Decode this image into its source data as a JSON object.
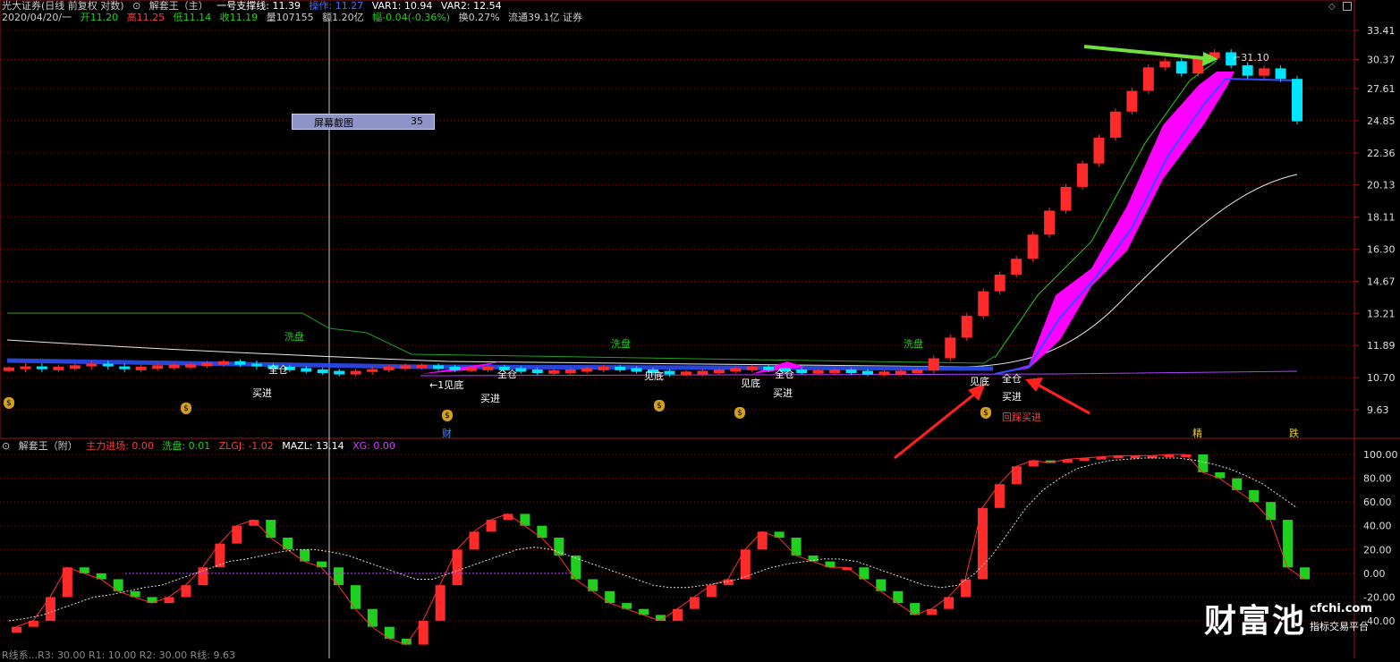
{
  "header": {
    "title": "光大证券(日线 前复权 对数)",
    "indicator_main": "解套王（主）",
    "support_label": "一号支撑线: 11.39",
    "var_blue": "操作: 11.27",
    "var1": "VAR1: 10.94",
    "var2": "VAR2: 12.54",
    "quote_date": "2020/04/20/一",
    "open": "开11.20",
    "high": "高11.25",
    "low": "低11.14",
    "close": "收11.19",
    "volume": "量107155",
    "amount": "额1.20亿",
    "change": "幅-0.04(-0.36%)",
    "turnover": "换0.27%",
    "float_cap": "流通39.1亿 证券"
  },
  "sub_header": {
    "indicator": "解套王（附）",
    "zljc": "主力进场: 0.00",
    "xipan": "洗盘: 0.01",
    "zlgj": "ZLGJ: -1.02",
    "mazl": "MAZL: 13.14",
    "xg": "XG: 0.00"
  },
  "bottom_label": "R线系...R3: 30.00  R1: 10.00  R2: 30.00  R线: 9.63",
  "screenshot_box": {
    "label": "屏幕截图",
    "value": "35"
  },
  "price_axis": [
    "33.41",
    "30.37",
    "27.61",
    "24.85",
    "22.36",
    "20.13",
    "18.11",
    "16.30",
    "14.67",
    "13.21",
    "11.89",
    "10.70",
    "9.63"
  ],
  "osc_axis": [
    "100.00",
    "80.00",
    "60.00",
    "40.00",
    "20.00",
    "0.00",
    "-20.00",
    "-40.00"
  ],
  "peak_label": "31.10",
  "signals": {
    "xipan": "洗盘",
    "quancang": "全仓",
    "mairu": "买进",
    "jiandi": "见底",
    "jiandi_arrow": "←1见底",
    "huicai": "回踩买进",
    "cai": "财",
    "jing": "精",
    "die": "跌"
  },
  "watermark": {
    "logo": "财富池",
    "site": "cfchi.com",
    "sub": "指标交易平台"
  },
  "colors": {
    "up": "#ff2a2a",
    "down": "#00e5ff",
    "magenta": "#ff00ff",
    "green": "#1fd01f",
    "frame": "#8a1a1a"
  },
  "chart_data": {
    "type": "candlestick",
    "x_axis": "trading days",
    "price_scale": "log",
    "ylim": [
      9.63,
      33.41
    ],
    "closes": [
      11.0,
      11.1,
      11.0,
      11.05,
      11.1,
      11.2,
      11.1,
      11.0,
      11.05,
      11.1,
      11.1,
      11.15,
      11.2,
      11.25,
      11.2,
      11.1,
      11.05,
      11.0,
      10.95,
      10.9,
      10.85,
      10.9,
      11.0,
      11.05,
      11.1,
      11.1,
      11.05,
      11.0,
      11.0,
      11.05,
      11.0,
      10.95,
      10.9,
      10.9,
      10.95,
      11.0,
      11.05,
      11.0,
      10.95,
      10.9,
      10.85,
      10.85,
      10.9,
      10.95,
      11.0,
      11.05,
      11.0,
      10.95,
      10.9,
      10.9,
      10.95,
      10.9,
      10.85,
      10.85,
      10.9,
      10.95,
      11.4,
      12.2,
      13.1,
      14.2,
      15.0,
      15.8,
      17.1,
      18.5,
      20.0,
      21.6,
      23.5,
      25.6,
      27.4,
      29.6,
      30.2,
      29.0,
      30.5,
      31.1,
      29.8,
      28.8,
      29.5,
      28.5,
      24.8
    ],
    "oscillator": [
      -45,
      -40,
      -20,
      5,
      0,
      -5,
      -15,
      -20,
      -25,
      -20,
      -10,
      5,
      25,
      40,
      45,
      30,
      20,
      10,
      5,
      -10,
      -30,
      -45,
      -55,
      -60,
      -40,
      -10,
      20,
      35,
      45,
      50,
      40,
      30,
      15,
      -5,
      -15,
      -25,
      -30,
      -35,
      -40,
      -30,
      -20,
      -10,
      -5,
      20,
      35,
      30,
      15,
      10,
      5,
      5,
      -5,
      -15,
      -25,
      -35,
      -30,
      -20,
      -5,
      55,
      75,
      90,
      95,
      93,
      96,
      97,
      98,
      99,
      99,
      99,
      100,
      100,
      85,
      80,
      70,
      60,
      45,
      5,
      -5
    ],
    "ma_signal": [
      -40,
      -38,
      -35,
      -30,
      -25,
      -20,
      -18,
      -15,
      -12,
      -10,
      -5,
      0,
      5,
      10,
      12,
      15,
      18,
      20,
      20,
      18,
      15,
      10,
      5,
      0,
      -5,
      -5,
      0,
      5,
      10,
      15,
      20,
      22,
      20,
      15,
      10,
      5,
      0,
      -5,
      -10,
      -12,
      -12,
      -10,
      -8,
      -5,
      0,
      5,
      8,
      10,
      12,
      12,
      10,
      5,
      0,
      -5,
      -10,
      -12,
      -10,
      0,
      15,
      35,
      55,
      70,
      80,
      88,
      92,
      95,
      96,
      97,
      97,
      97,
      95,
      92,
      88,
      82,
      75,
      65,
      55
    ],
    "ylim_osc": [
      -50,
      105
    ]
  }
}
